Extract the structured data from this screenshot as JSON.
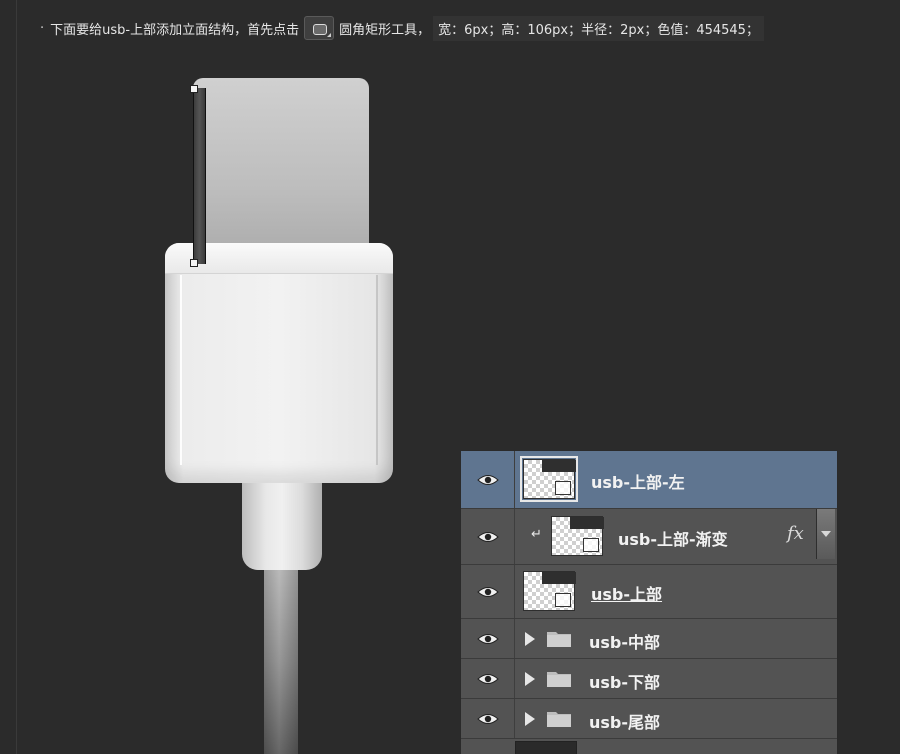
{
  "instruction": {
    "bullet": "·",
    "text_before": "下面要给usb-上部添加立面结构，首先点击",
    "tool_icon": "rounded-rectangle-tool-icon",
    "text_after": "圆角矩形工具，",
    "spec": "宽：6px；高：106px；半径：2px；色值：454545；"
  },
  "layers": [
    {
      "name": "usb-上部-左",
      "selected": true,
      "visible": true,
      "type": "shape"
    },
    {
      "name": "usb-上部-渐变",
      "selected": false,
      "visible": true,
      "type": "shape",
      "clipped": true,
      "fx": "fx"
    },
    {
      "name": "usb-上部",
      "selected": false,
      "visible": true,
      "type": "shape",
      "underline": true
    },
    {
      "name": "usb-中部",
      "selected": false,
      "visible": true,
      "type": "group"
    },
    {
      "name": "usb-下部",
      "selected": false,
      "visible": true,
      "type": "group"
    },
    {
      "name": "usb-尾部",
      "selected": false,
      "visible": true,
      "type": "group"
    }
  ],
  "icons": {
    "eye": "eye-icon",
    "folder": "folder-icon",
    "clip": "clipping-arrow-icon",
    "fx": "fx-icon"
  },
  "colors": {
    "canvas_bg": "#2b2b2b",
    "panel_bg": "#535353",
    "selected_row": "#5f7590",
    "shape_color": "#454545"
  }
}
